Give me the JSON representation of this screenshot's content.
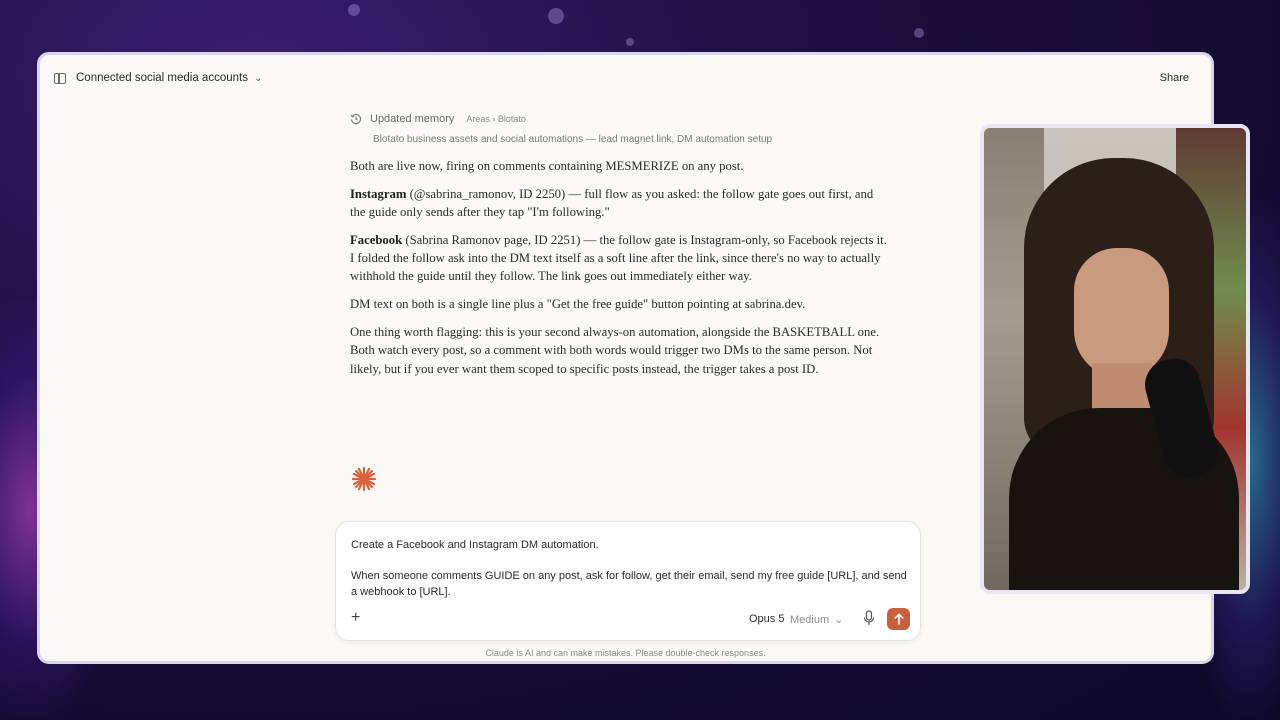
{
  "topbar": {
    "title": "Connected social media accounts",
    "share_label": "Share"
  },
  "memory": {
    "label": "Updated memory",
    "path": "Areas › Blotato",
    "description": "Blotato business assets and social automations — lead magnet link, DM automation setup"
  },
  "reply": {
    "p1": "Both are live now, firing on comments containing MESMERIZE on any post.",
    "p2_bold": "Instagram",
    "p2_rest": " (@sabrina_ramonov, ID 2250) — full flow as you asked: the follow gate goes out first, and the guide only sends after they tap \"I'm following.\"",
    "p3_bold": "Facebook",
    "p3_rest": " (Sabrina Ramonov page, ID 2251) — the follow gate is Instagram-only, so Facebook rejects it. I folded the follow ask into the DM text itself as a soft line after the link, since there's no way to actually withhold the guide until they follow. The link goes out immediately either way.",
    "p4": "DM text on both is a single line plus a \"Get the free guide\" button pointing at sabrina.dev.",
    "p5": "One thing worth flagging: this is your second always-on automation, alongside the BASKETBALL one. Both watch every post, so a comment with both words would trigger two DMs to the same person. Not likely, but if you ever want them scoped to specific posts instead, the trigger takes a post ID."
  },
  "composer": {
    "text": "Create a Facebook and Instagram DM automation.\n\nWhen someone comments GUIDE on any post, ask for follow, get their email, send my free guide [URL], and send a webhook to [URL].",
    "model": "Opus 5",
    "effort": "Medium"
  },
  "disclaimer": "Claude is AI and can make mistakes. Please double-check responses.",
  "colors": {
    "accent": "#c6613f",
    "window_bg": "#faf9f5"
  },
  "icons": [
    "sidebar-toggle-icon",
    "chevron-down-icon",
    "history-icon",
    "claude-spark-icon",
    "plus-icon",
    "microphone-icon",
    "arrow-up-icon"
  ]
}
